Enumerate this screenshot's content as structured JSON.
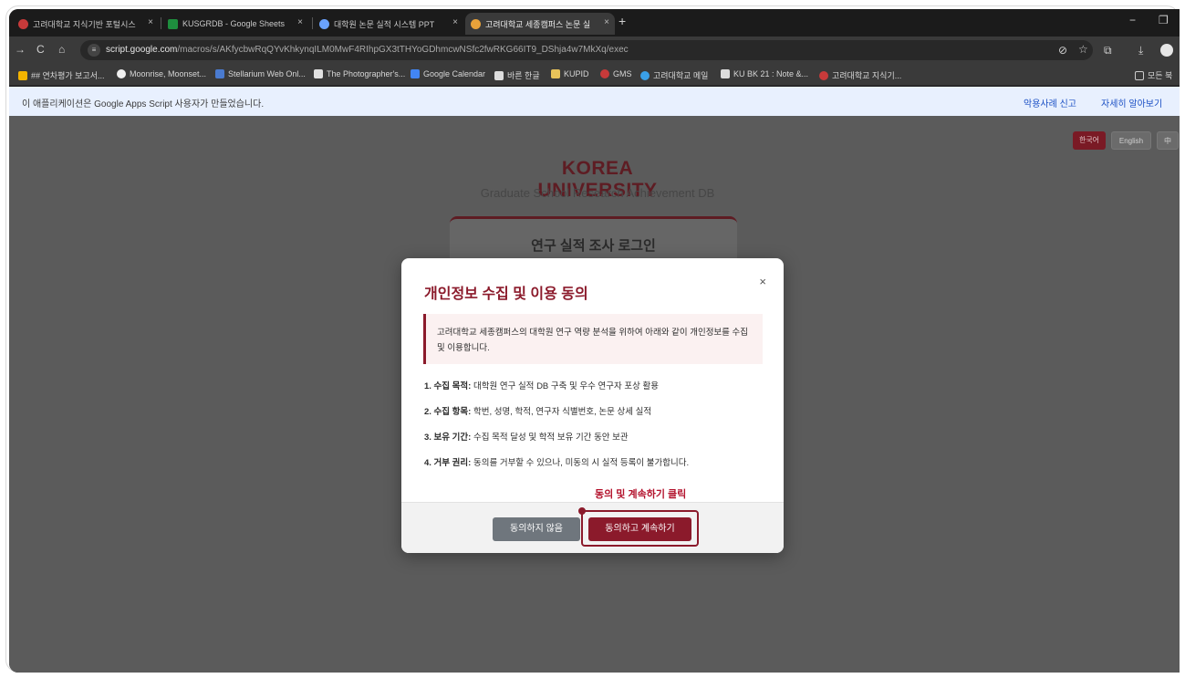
{
  "tabs": [
    {
      "label": "고려대학교 지식기반 포털시스",
      "color": "#c73a3a"
    },
    {
      "label": "KUSGRDB - Google Sheets",
      "color": "#1e8e3e"
    },
    {
      "label": "대학원 논문 실적 시스템 PPT",
      "color": "#6aa3ff"
    },
    {
      "label": "고려대학교 세종캠퍼스 논문 실",
      "color": "#e8a23a"
    }
  ],
  "tab_close": "×",
  "new_tab": "+",
  "window": {
    "minimize": "−",
    "restore": "❐"
  },
  "nav": {
    "back": "→",
    "reload": "C",
    "home": "⌂"
  },
  "url": {
    "host": "script.google.com",
    "path": "/macros/s/AKfycbwRqQYvKhkynqILM0MwF4RIhpGX3tTHYoGDhmcwNSfc2fwRKG66IT9_DShja4w7MkXq/exec"
  },
  "bookmarks": [
    {
      "label": "## 연차평가 보고서...",
      "color": "#f4b400"
    },
    {
      "label": "Moonrise, Moonset...",
      "color": "#f0f0f0"
    },
    {
      "label": "Stellarium Web Onl...",
      "color": "#4a7bd0"
    },
    {
      "label": "The Photographer's...",
      "color": "#e0e0e0"
    },
    {
      "label": "Google Calendar",
      "color": "#4285f4"
    },
    {
      "label": "바른 한글",
      "color": "#dddddd"
    },
    {
      "label": "KUPID",
      "color": "#e8c35a"
    },
    {
      "label": "GMS",
      "color": "#c73a3a"
    },
    {
      "label": "고려대학교 메일",
      "color": "#3aa0e8"
    },
    {
      "label": "KU BK 21 : Note &...",
      "color": "#dddddd"
    },
    {
      "label": "고려대학교 지식기...",
      "color": "#c73a3a"
    }
  ],
  "all_bookmarks": "모든 북",
  "infobar": {
    "message": "이 애플리케이션은 Google Apps Script 사용자가 만들었습니다.",
    "report": "악용사례 신고",
    "learn_more": "자세히 알아보기"
  },
  "languages": [
    "한국어",
    "English",
    "中"
  ],
  "brand": {
    "title": "KOREA UNIVERSITY",
    "subtitle": "Graduate School Research Achievement DB"
  },
  "login_title": "연구 실적 조사 로그인",
  "modal": {
    "title": "개인정보 수집 및 이용 동의",
    "close": "×",
    "notice": "고려대학교 세종캠퍼스의 대학원 연구 역량 분석을 위하여 아래와 같이 개인정보를 수집 및 이용합니다.",
    "items": [
      {
        "label": "1. 수집 목적:",
        "text": " 대학원 연구 실적 DB 구축 및 우수 연구자 포상 활용"
      },
      {
        "label": "2. 수집 항목:",
        "text": " 학번, 성명, 학적, 연구자 식별번호, 논문 상세 실적"
      },
      {
        "label": "3. 보유 기간:",
        "text": " 수집 목적 달성 및 학적 보유 기간 동안 보관"
      },
      {
        "label": "4. 거부 권리:",
        "text": " 동의를 거부할 수 있으나, 미동의 시 실적 등록이 불가합니다."
      }
    ],
    "annotation": "동의 및 계속하기 클릭",
    "decline_button": "동의하지 않음",
    "agree_button": "동의하고 계속하기"
  },
  "colors": {
    "accent": "#8b1a2b",
    "brand": "#5e1c23",
    "overlay": "#5b5b5b"
  }
}
